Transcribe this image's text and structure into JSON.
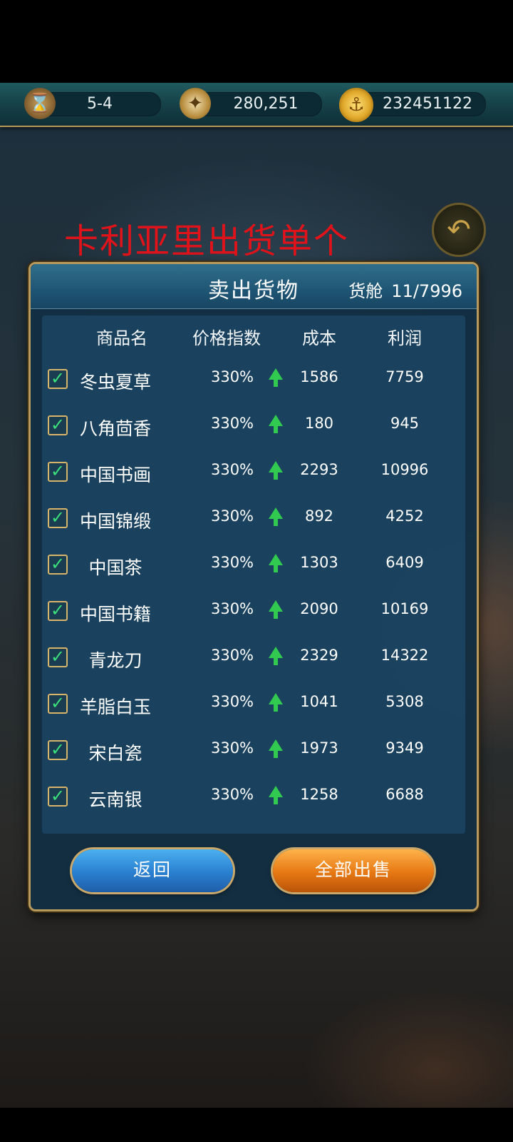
{
  "topbar": {
    "time_icon": "hourglass-icon",
    "time_value": "5-4",
    "compass_icon": "compass-icon",
    "reputation_value": "280,251",
    "coin_icon": "anchor-coin-icon",
    "gold_value": "232451122"
  },
  "annotation": "卡利亚里出货单个",
  "dialog": {
    "title": "卖出货物",
    "cargo_label": "货舱",
    "cargo_value": "11/7996",
    "headers": {
      "name": "商品名",
      "price_index": "价格指数",
      "cost": "成本",
      "profit": "利润"
    },
    "rows": [
      {
        "name": "冬虫夏草",
        "price_index": "330%",
        "cost": "1586",
        "profit": "7759",
        "checked": true
      },
      {
        "name": "八角茴香",
        "price_index": "330%",
        "cost": "180",
        "profit": "945",
        "checked": true
      },
      {
        "name": "中国书画",
        "price_index": "330%",
        "cost": "2293",
        "profit": "10996",
        "checked": true
      },
      {
        "name": "中国锦缎",
        "price_index": "330%",
        "cost": "892",
        "profit": "4252",
        "checked": true
      },
      {
        "name": "中国茶",
        "price_index": "330%",
        "cost": "1303",
        "profit": "6409",
        "checked": true
      },
      {
        "name": "中国书籍",
        "price_index": "330%",
        "cost": "2090",
        "profit": "10169",
        "checked": true
      },
      {
        "name": "青龙刀",
        "price_index": "330%",
        "cost": "2329",
        "profit": "14322",
        "checked": true
      },
      {
        "name": "羊脂白玉",
        "price_index": "330%",
        "cost": "1041",
        "profit": "5308",
        "checked": true
      },
      {
        "name": "宋白瓷",
        "price_index": "330%",
        "cost": "1973",
        "profit": "9349",
        "checked": true
      },
      {
        "name": "云南银",
        "price_index": "330%",
        "cost": "1258",
        "profit": "6688",
        "checked": true
      }
    ],
    "back_button": "返回",
    "sell_all_button": "全部出售"
  },
  "colors": {
    "trend_up": "#31c94f",
    "check": "#3be07a",
    "annotation": "#e0131b"
  }
}
